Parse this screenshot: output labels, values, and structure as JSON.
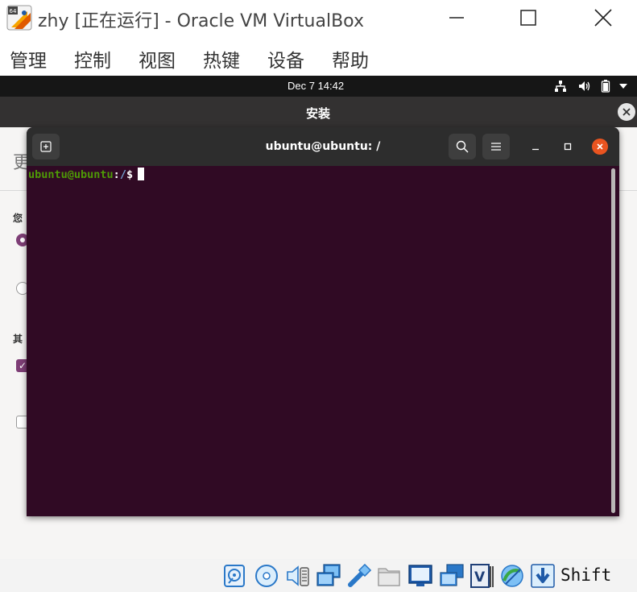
{
  "window": {
    "title": "zhy [正在运行] - Oracle VM VirtualBox",
    "logo_badge": "64"
  },
  "menubar": {
    "items": [
      "管理",
      "控制",
      "视图",
      "热键",
      "设备",
      "帮助"
    ]
  },
  "guest_topbar": {
    "clock": "Dec 7  14:42"
  },
  "installer": {
    "title": "安装",
    "partial_heading": "更",
    "partial_label1": "您",
    "partial_label2": "其"
  },
  "terminal": {
    "title": "ubuntu@ubuntu: /",
    "prompt_user": "ubuntu@ubuntu",
    "prompt_sep": ":",
    "prompt_path": "/",
    "prompt_symbol": "$"
  },
  "statusbar": {
    "host_key": "Shift"
  },
  "colors": {
    "terminal_bg": "#300a24",
    "prompt_user": "#4e9a06",
    "prompt_path": "#729fcf",
    "close_orange": "#e95420",
    "installer_accent": "#7e3e76"
  }
}
